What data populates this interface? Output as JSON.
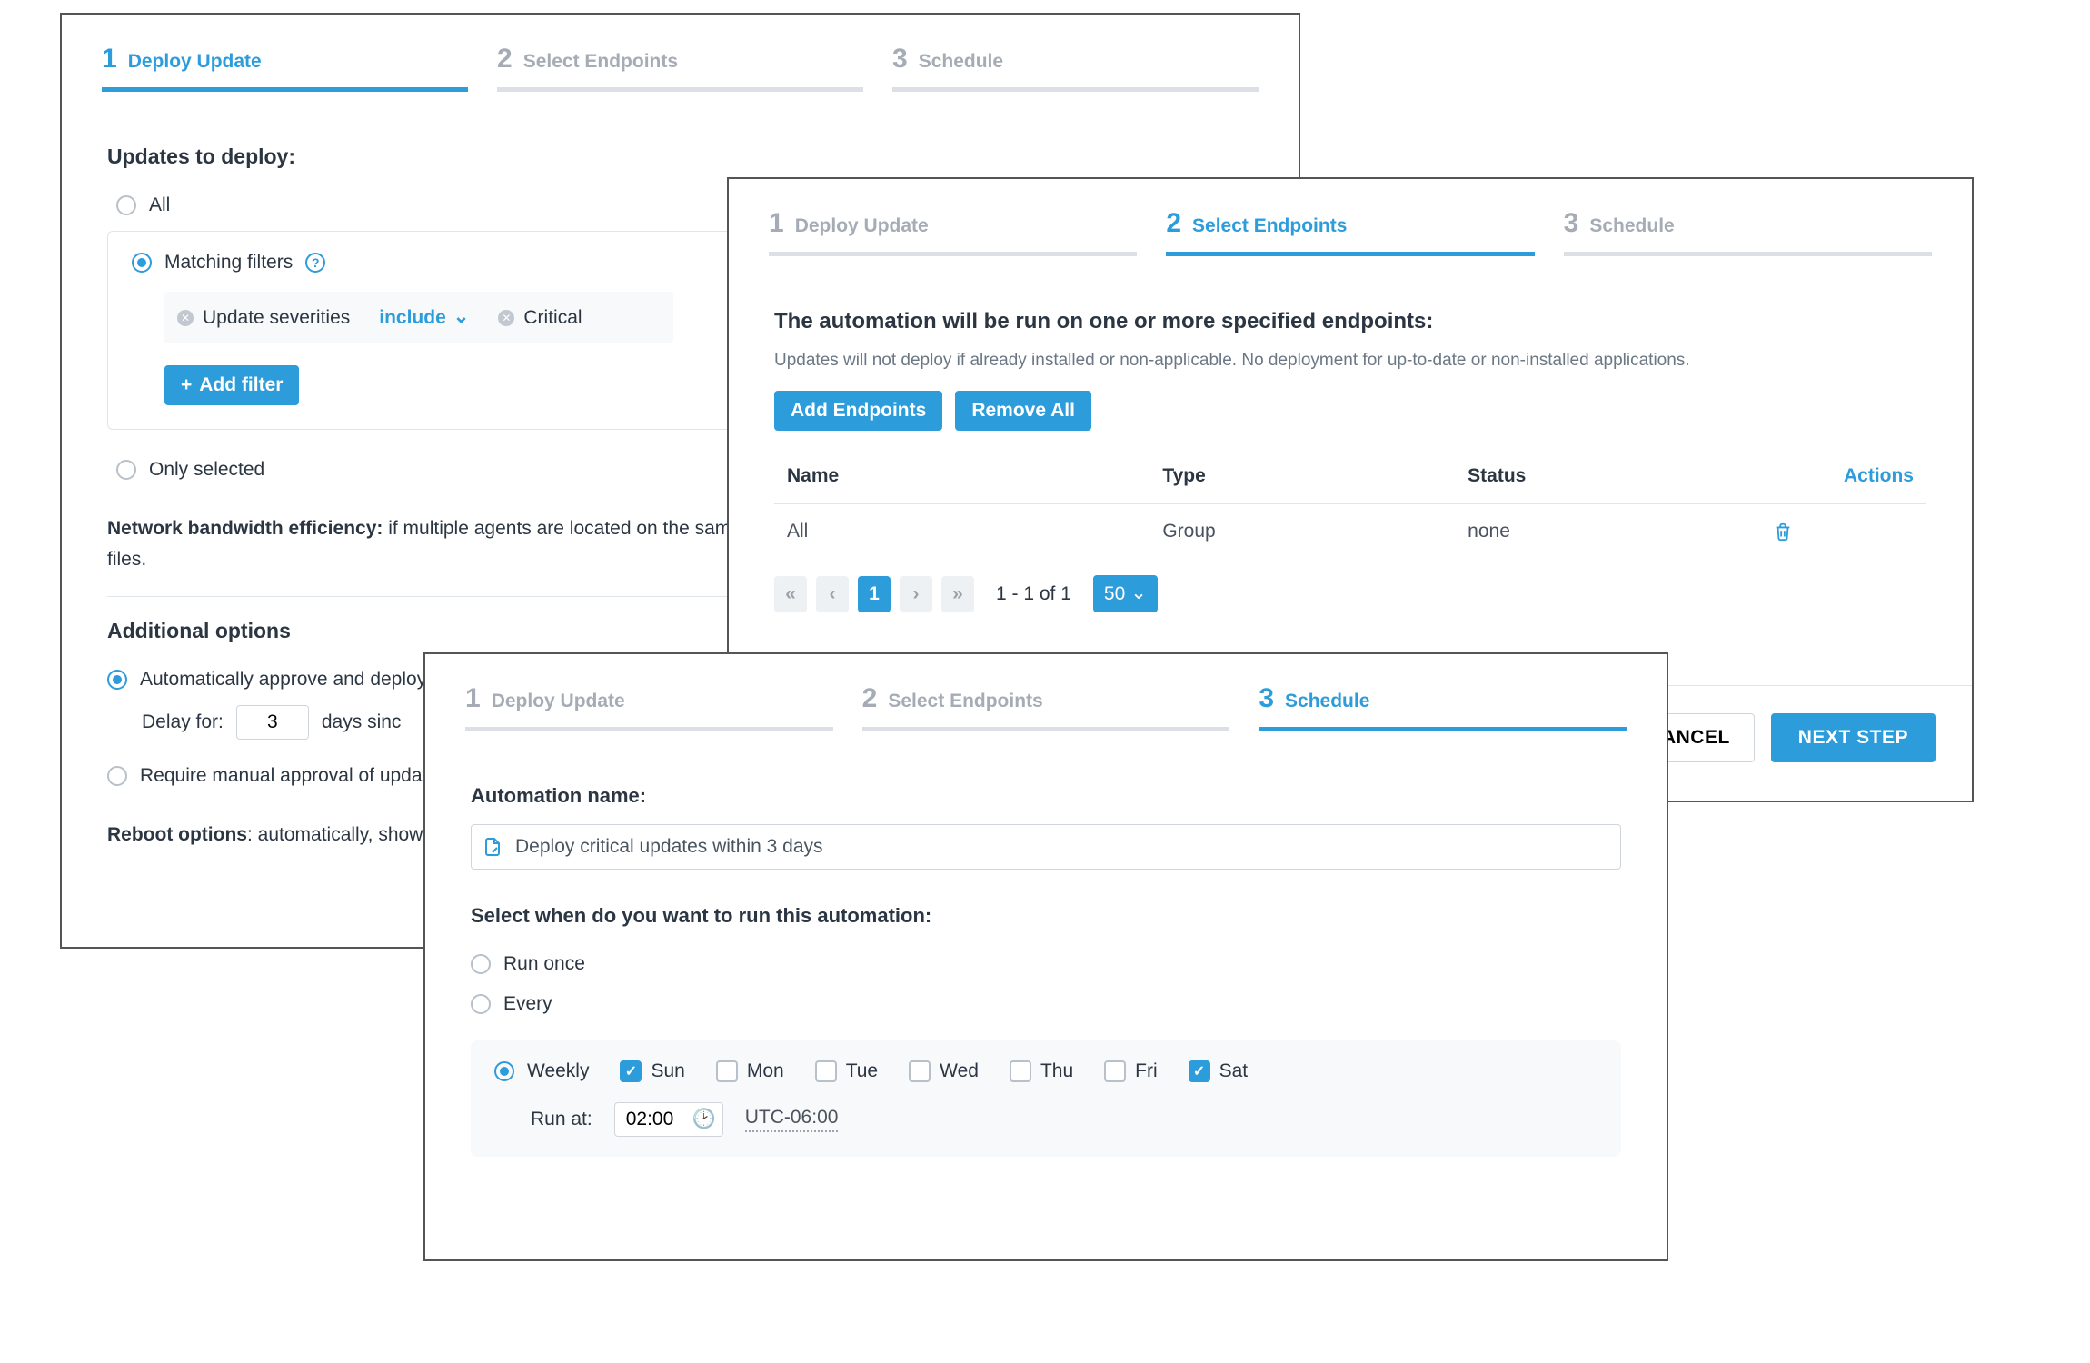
{
  "stepper": {
    "s1": "Deploy Update",
    "s2": "Select Endpoints",
    "s3": "Schedule"
  },
  "panel1": {
    "updates_title": "Updates to deploy:",
    "opt_all": "All",
    "opt_matching": "Matching filters",
    "filter": {
      "field": "Update severities",
      "operator": "include",
      "value": "Critical"
    },
    "add_filter": "Add filter",
    "opt_selected": "Only selected",
    "bandwidth_label": "Network bandwidth efficiency:",
    "bandwidth_text": " if multiple agents are located on the same LAN, t",
    "bandwidth_tail": "files.",
    "additional_title": "Additional options",
    "auto_approve": "Automatically approve and deploy a",
    "delay_for": "Delay for:",
    "delay_value": "3",
    "days_since": "days sinc",
    "manual_approval": "Require manual approval of updates",
    "reboot_label": "Reboot options",
    "reboot_text": ": automatically, show th"
  },
  "panel2": {
    "heading": "The automation will be run on one or more specified endpoints:",
    "subheading": "Updates will not deploy if already installed or non-applicable. No deployment for up-to-date or non-installed applications.",
    "add_endpoints": "Add Endpoints",
    "remove_all": "Remove All",
    "cols": {
      "name": "Name",
      "type": "Type",
      "status": "Status",
      "actions": "Actions"
    },
    "rows": [
      {
        "name": "All",
        "type": "Group",
        "status": "none"
      }
    ],
    "pager": {
      "page": "1",
      "range": "1 - 1 of 1",
      "size": "50"
    },
    "cancel": "CANCEL",
    "next": "NEXT STEP"
  },
  "panel3": {
    "name_label": "Automation name:",
    "name_value": "Deploy critical updates within 3 days",
    "select_when": "Select when do you want to run this automation:",
    "run_once": "Run once",
    "every": "Every",
    "weekly": "Weekly",
    "days": {
      "sun": "Sun",
      "mon": "Mon",
      "tue": "Tue",
      "wed": "Wed",
      "thu": "Thu",
      "fri": "Fri",
      "sat": "Sat"
    },
    "run_at_label": "Run at:",
    "run_at_time": "02:00",
    "tz": "UTC-06:00"
  }
}
